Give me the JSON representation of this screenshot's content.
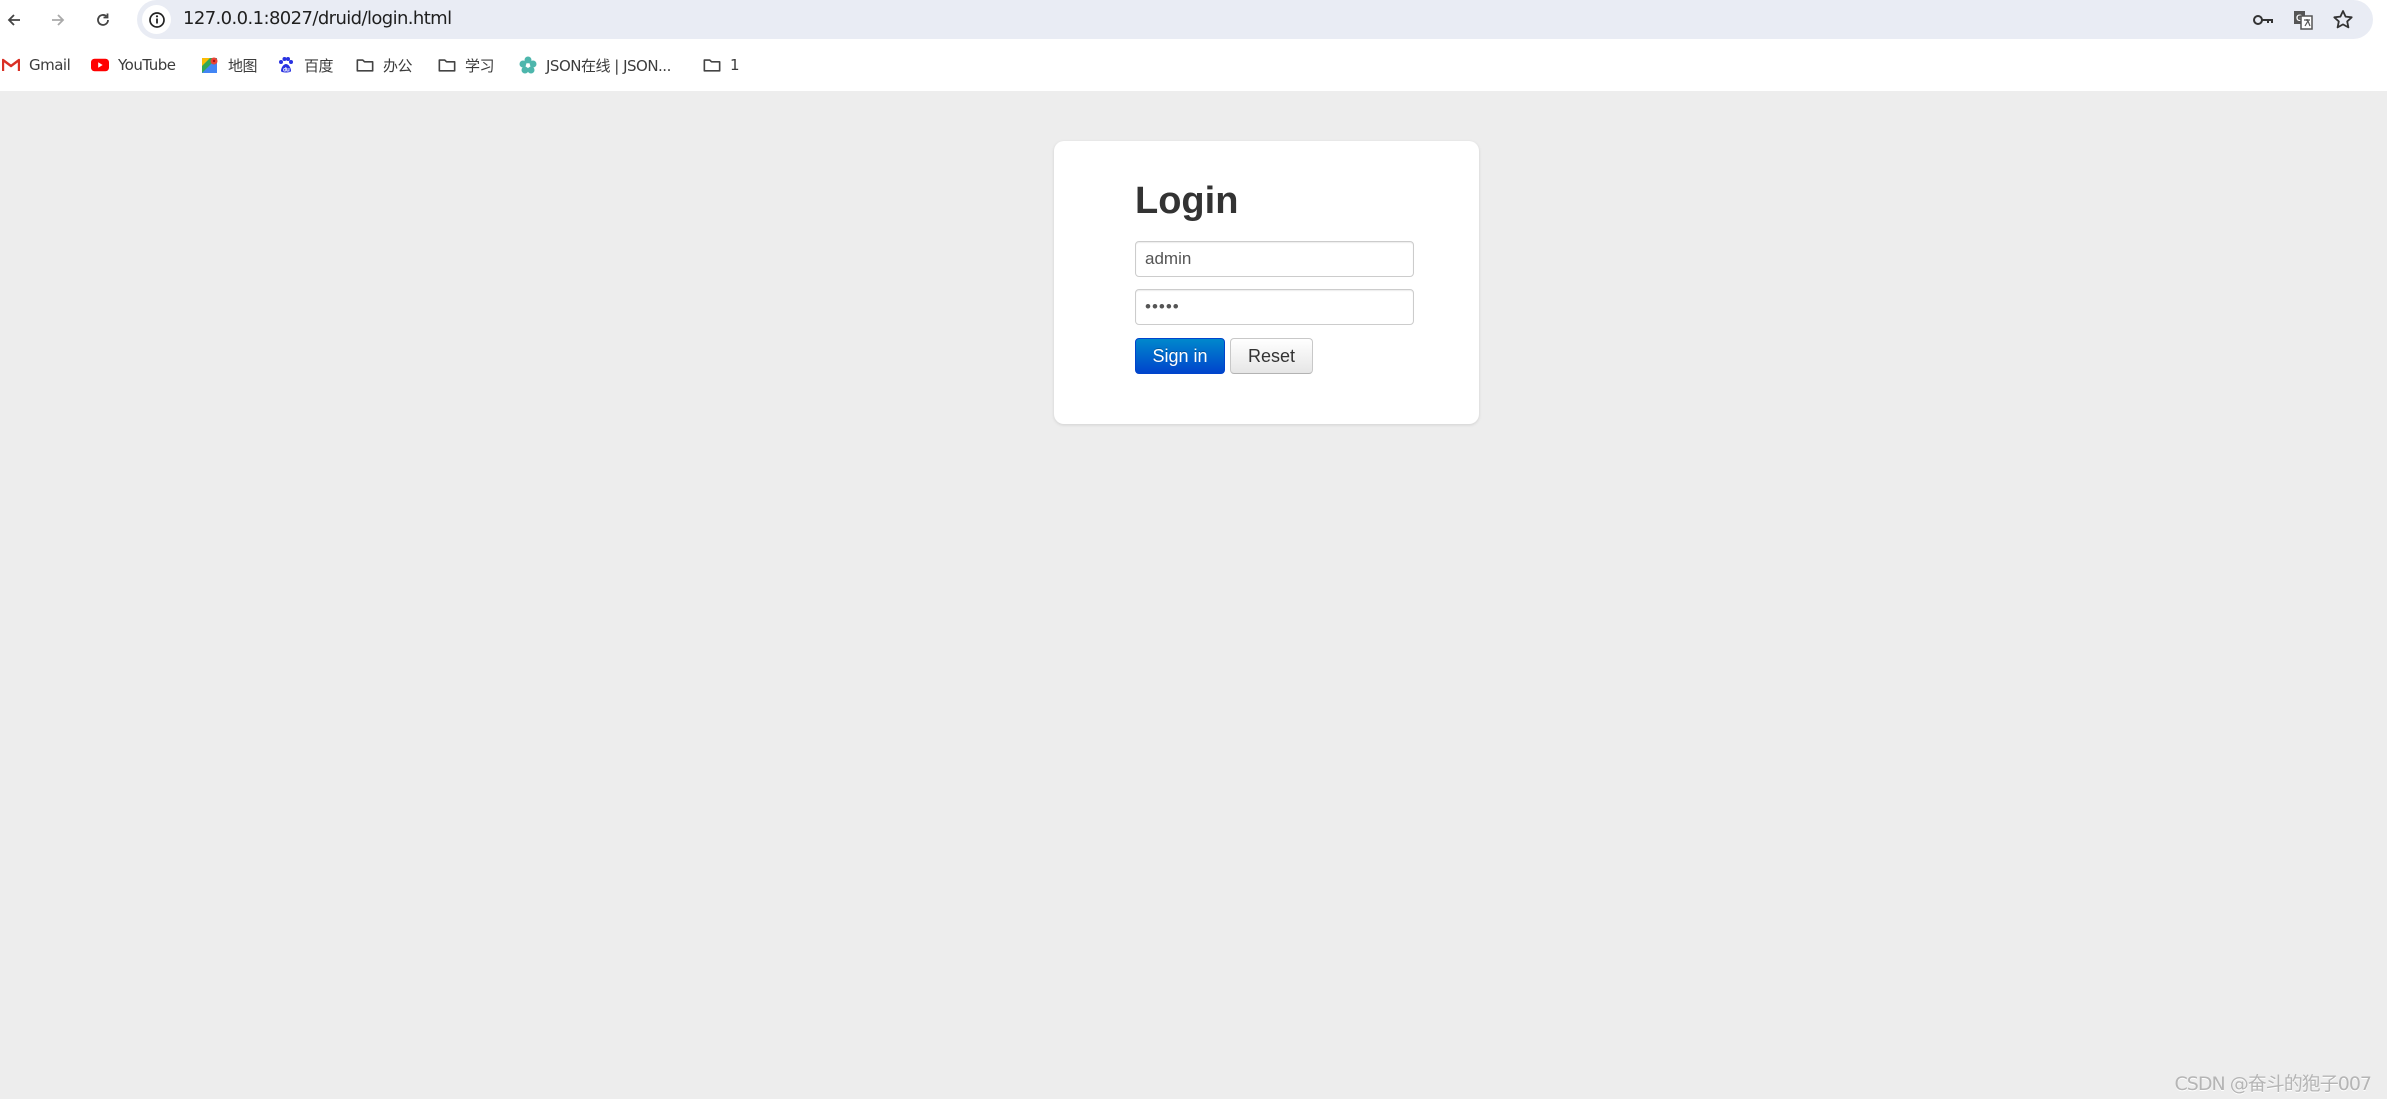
{
  "browser": {
    "url": "127.0.0.1:8027/druid/login.html",
    "nav": {
      "back_icon": "arrow-left-icon",
      "forward_icon": "arrow-right-icon",
      "reload_icon": "reload-icon",
      "site_info_icon": "info-icon"
    },
    "omnibox_icons": [
      "key-icon",
      "translate-icon",
      "star-icon"
    ],
    "bookmarks": [
      {
        "label": "Gmail",
        "icon": "gmail-icon"
      },
      {
        "label": "YouTube",
        "icon": "youtube-icon"
      },
      {
        "label": "地图",
        "icon": "maps-icon"
      },
      {
        "label": "百度",
        "icon": "baidu-icon"
      },
      {
        "label": "办公",
        "icon": "folder-icon"
      },
      {
        "label": "学习",
        "icon": "folder-icon"
      },
      {
        "label": "JSON在线 | JSON...",
        "icon": "json-flower-icon"
      },
      {
        "label": "1",
        "icon": "folder-icon"
      }
    ]
  },
  "login": {
    "title": "Login",
    "username_value": "admin",
    "password_value": "•••••",
    "sign_in_label": "Sign in",
    "reset_label": "Reset"
  },
  "colors": {
    "primary_top": "#0088cc",
    "primary_bottom": "#0044cc",
    "page_background": "#ededed"
  },
  "watermark": "CSDN @奋斗的狍子007"
}
